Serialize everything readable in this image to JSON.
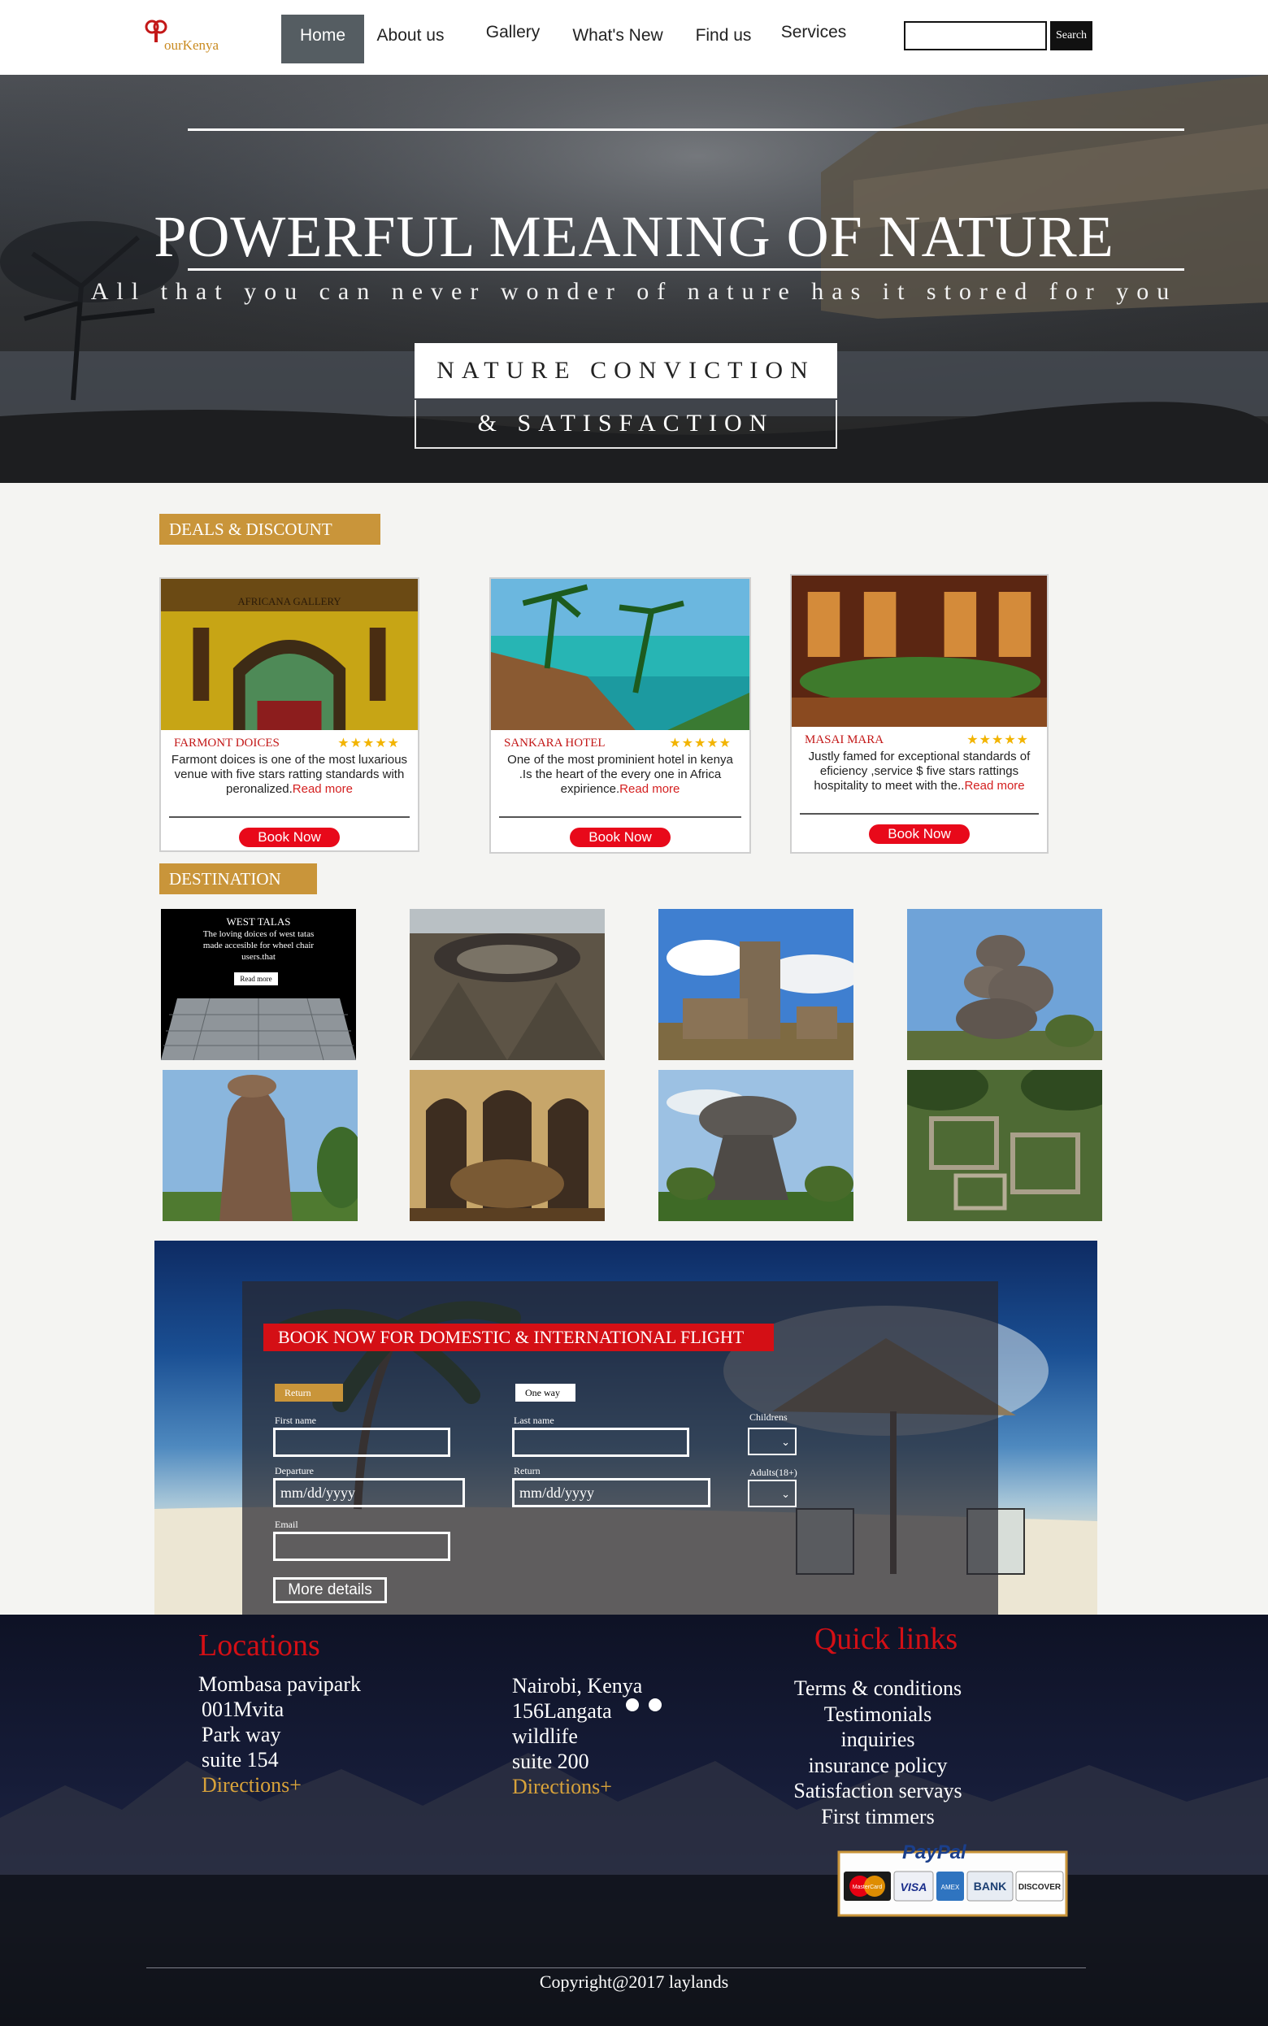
{
  "header": {
    "logo_text": "ourKenya",
    "nav": [
      "Home",
      "About us",
      "Gallery",
      "What's New",
      "Find us",
      "Services"
    ],
    "search_button": "Search"
  },
  "hero": {
    "title": "POWERFUL MEANING OF NATURE",
    "subtitle": "All that you can never wonder of nature has it stored for you",
    "box_line1": "NATURE CONVICTION",
    "box_line2": "& SATISFACTION"
  },
  "deals": {
    "heading": "DEALS & DISCOUNT",
    "stars": "★★★★★",
    "book_label": "Book Now",
    "read_more": "Read more",
    "items": [
      {
        "name": "FARMONT DOICES",
        "desc": "Farmont doices is one of the most luxarious venue with five stars ratting standards with peronalized."
      },
      {
        "name": "SANKARA HOTEL",
        "desc": "One of the most prominient hotel in kenya .Is the heart of the every one in Africa expirience."
      },
      {
        "name": "MASAI MARA",
        "desc": "Justly famed for exceptional standards of eficiency ,service $ five stars rattings hospitality to meet with the.."
      }
    ]
  },
  "destination": {
    "heading": "DESTINATION",
    "featured": {
      "title": "WEST TALAS",
      "text": "The loving doices of west tatas made accesible for wheel chair users.that",
      "button": "Read more"
    }
  },
  "booking": {
    "title": "BOOK NOW FOR DOMESTIC & INTERNATIONAL FLIGHT",
    "tab_return": "Return",
    "tab_oneway": "One way",
    "first_name_label": "First name",
    "last_name_label": "Last name",
    "children_label": "Childrens",
    "departure_label": "Departure",
    "return_label": "Return",
    "adults_label": "Adults(18+)",
    "departure_value": "mm/dd/yyyy",
    "return_value": "mm/dd/yyyy",
    "email_label": "Email",
    "more_details": "More details"
  },
  "footer": {
    "locations_heading": "Locations",
    "location1": [
      "Mombasa pavipark",
      "001Mvita",
      "Park way",
      "suite 154"
    ],
    "location2": [
      "Nairobi, Kenya",
      "156Langata",
      "wildlife",
      "suite 200"
    ],
    "directions": "Directions+",
    "quick_links_heading": "Quick links",
    "quick_links": [
      "Terms & conditions",
      "Testimonials",
      "inquiries",
      "insurance policy",
      "Satisfaction servays",
      "First timmers"
    ],
    "payment_brands": [
      "PayPal",
      "MasterCard",
      "VISA",
      "AMEX",
      "BANK",
      "DISCOVER"
    ],
    "copyright": "Copyright@2017 laylands"
  }
}
